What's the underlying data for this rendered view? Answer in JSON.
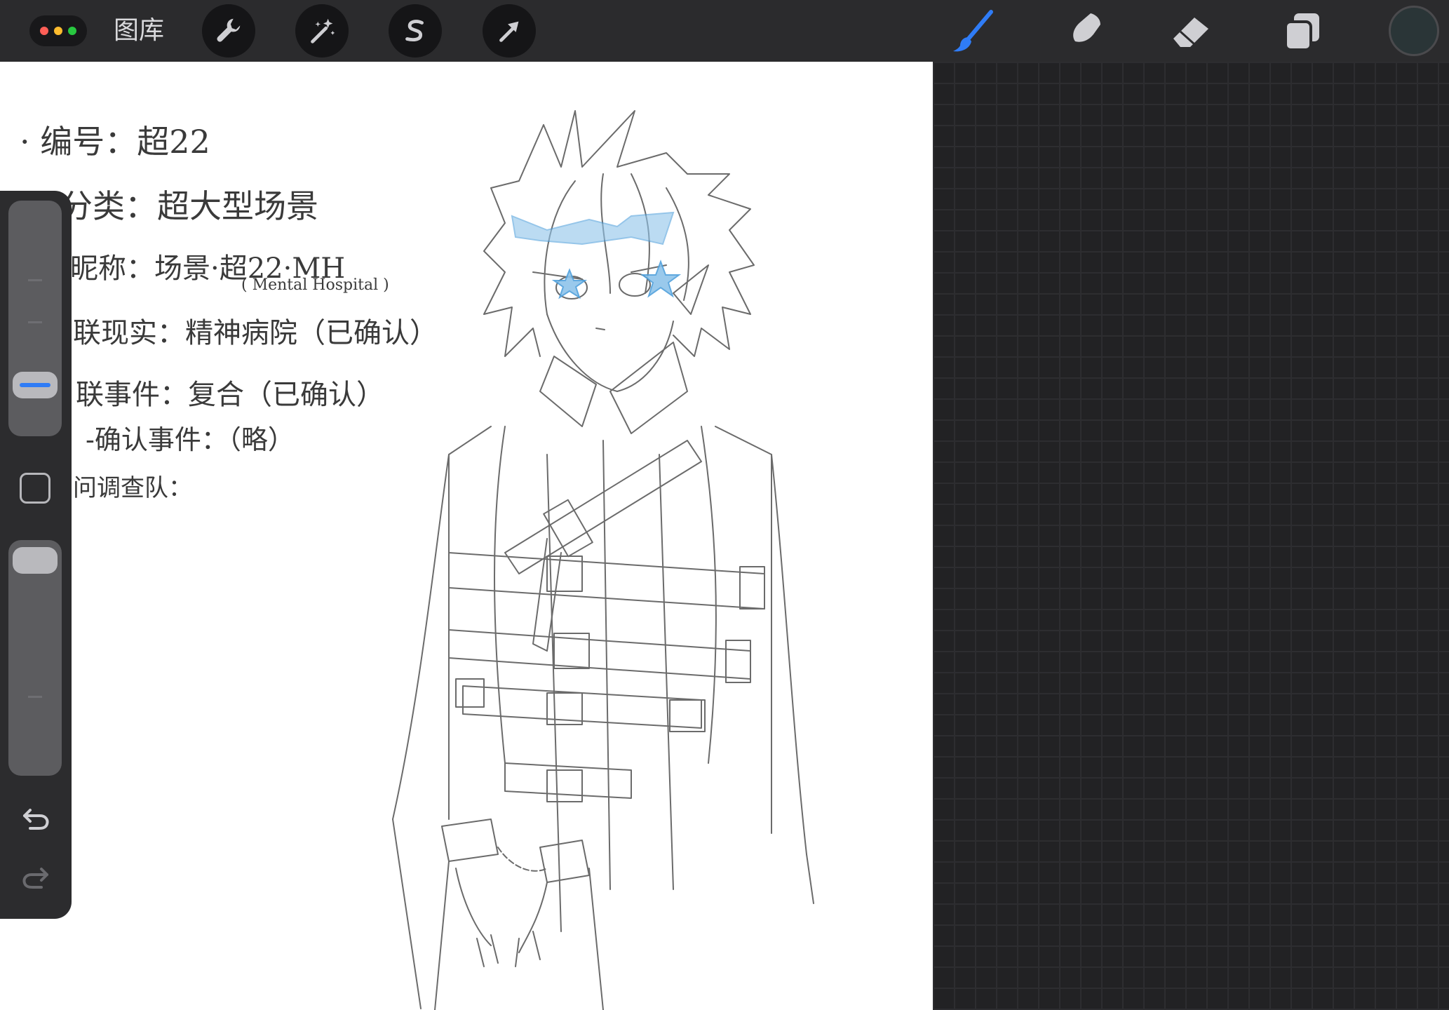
{
  "topbar": {
    "gallery_label": "图库",
    "window_dots": [
      "#ff5f57",
      "#febc2e",
      "#28c840"
    ],
    "left_tools": [
      {
        "name": "wrench-icon",
        "label": "Actions"
      },
      {
        "name": "magic-wand-icon",
        "label": "Adjustments"
      },
      {
        "name": "selection-icon",
        "label": "Selection"
      },
      {
        "name": "arrow-cursor-icon",
        "label": "Transform"
      }
    ],
    "right_tools": [
      {
        "name": "brush-icon",
        "label": "Paint",
        "active": true
      },
      {
        "name": "smudge-icon",
        "label": "Smudge"
      },
      {
        "name": "eraser-icon",
        "label": "Erase"
      },
      {
        "name": "layers-icon",
        "label": "Layers"
      }
    ],
    "current_color": "#2a3537",
    "accent_color": "#2f7cf6"
  },
  "canvas": {
    "notes": [
      "· 编号：超22",
      "分类：超大型场景",
      "昵称：场景·超22·MH",
      "( Mental Hospital )",
      "联现实：精神病院（已确认）",
      "联事件：复合（已确认）",
      "-确认事件：（略）",
      "问调查队："
    ]
  },
  "sidebar": {
    "brush_size_level": 0.22,
    "opacity_level": 0.0,
    "modify_button": "square-icon",
    "undo": "undo-icon",
    "redo": "redo-icon"
  }
}
